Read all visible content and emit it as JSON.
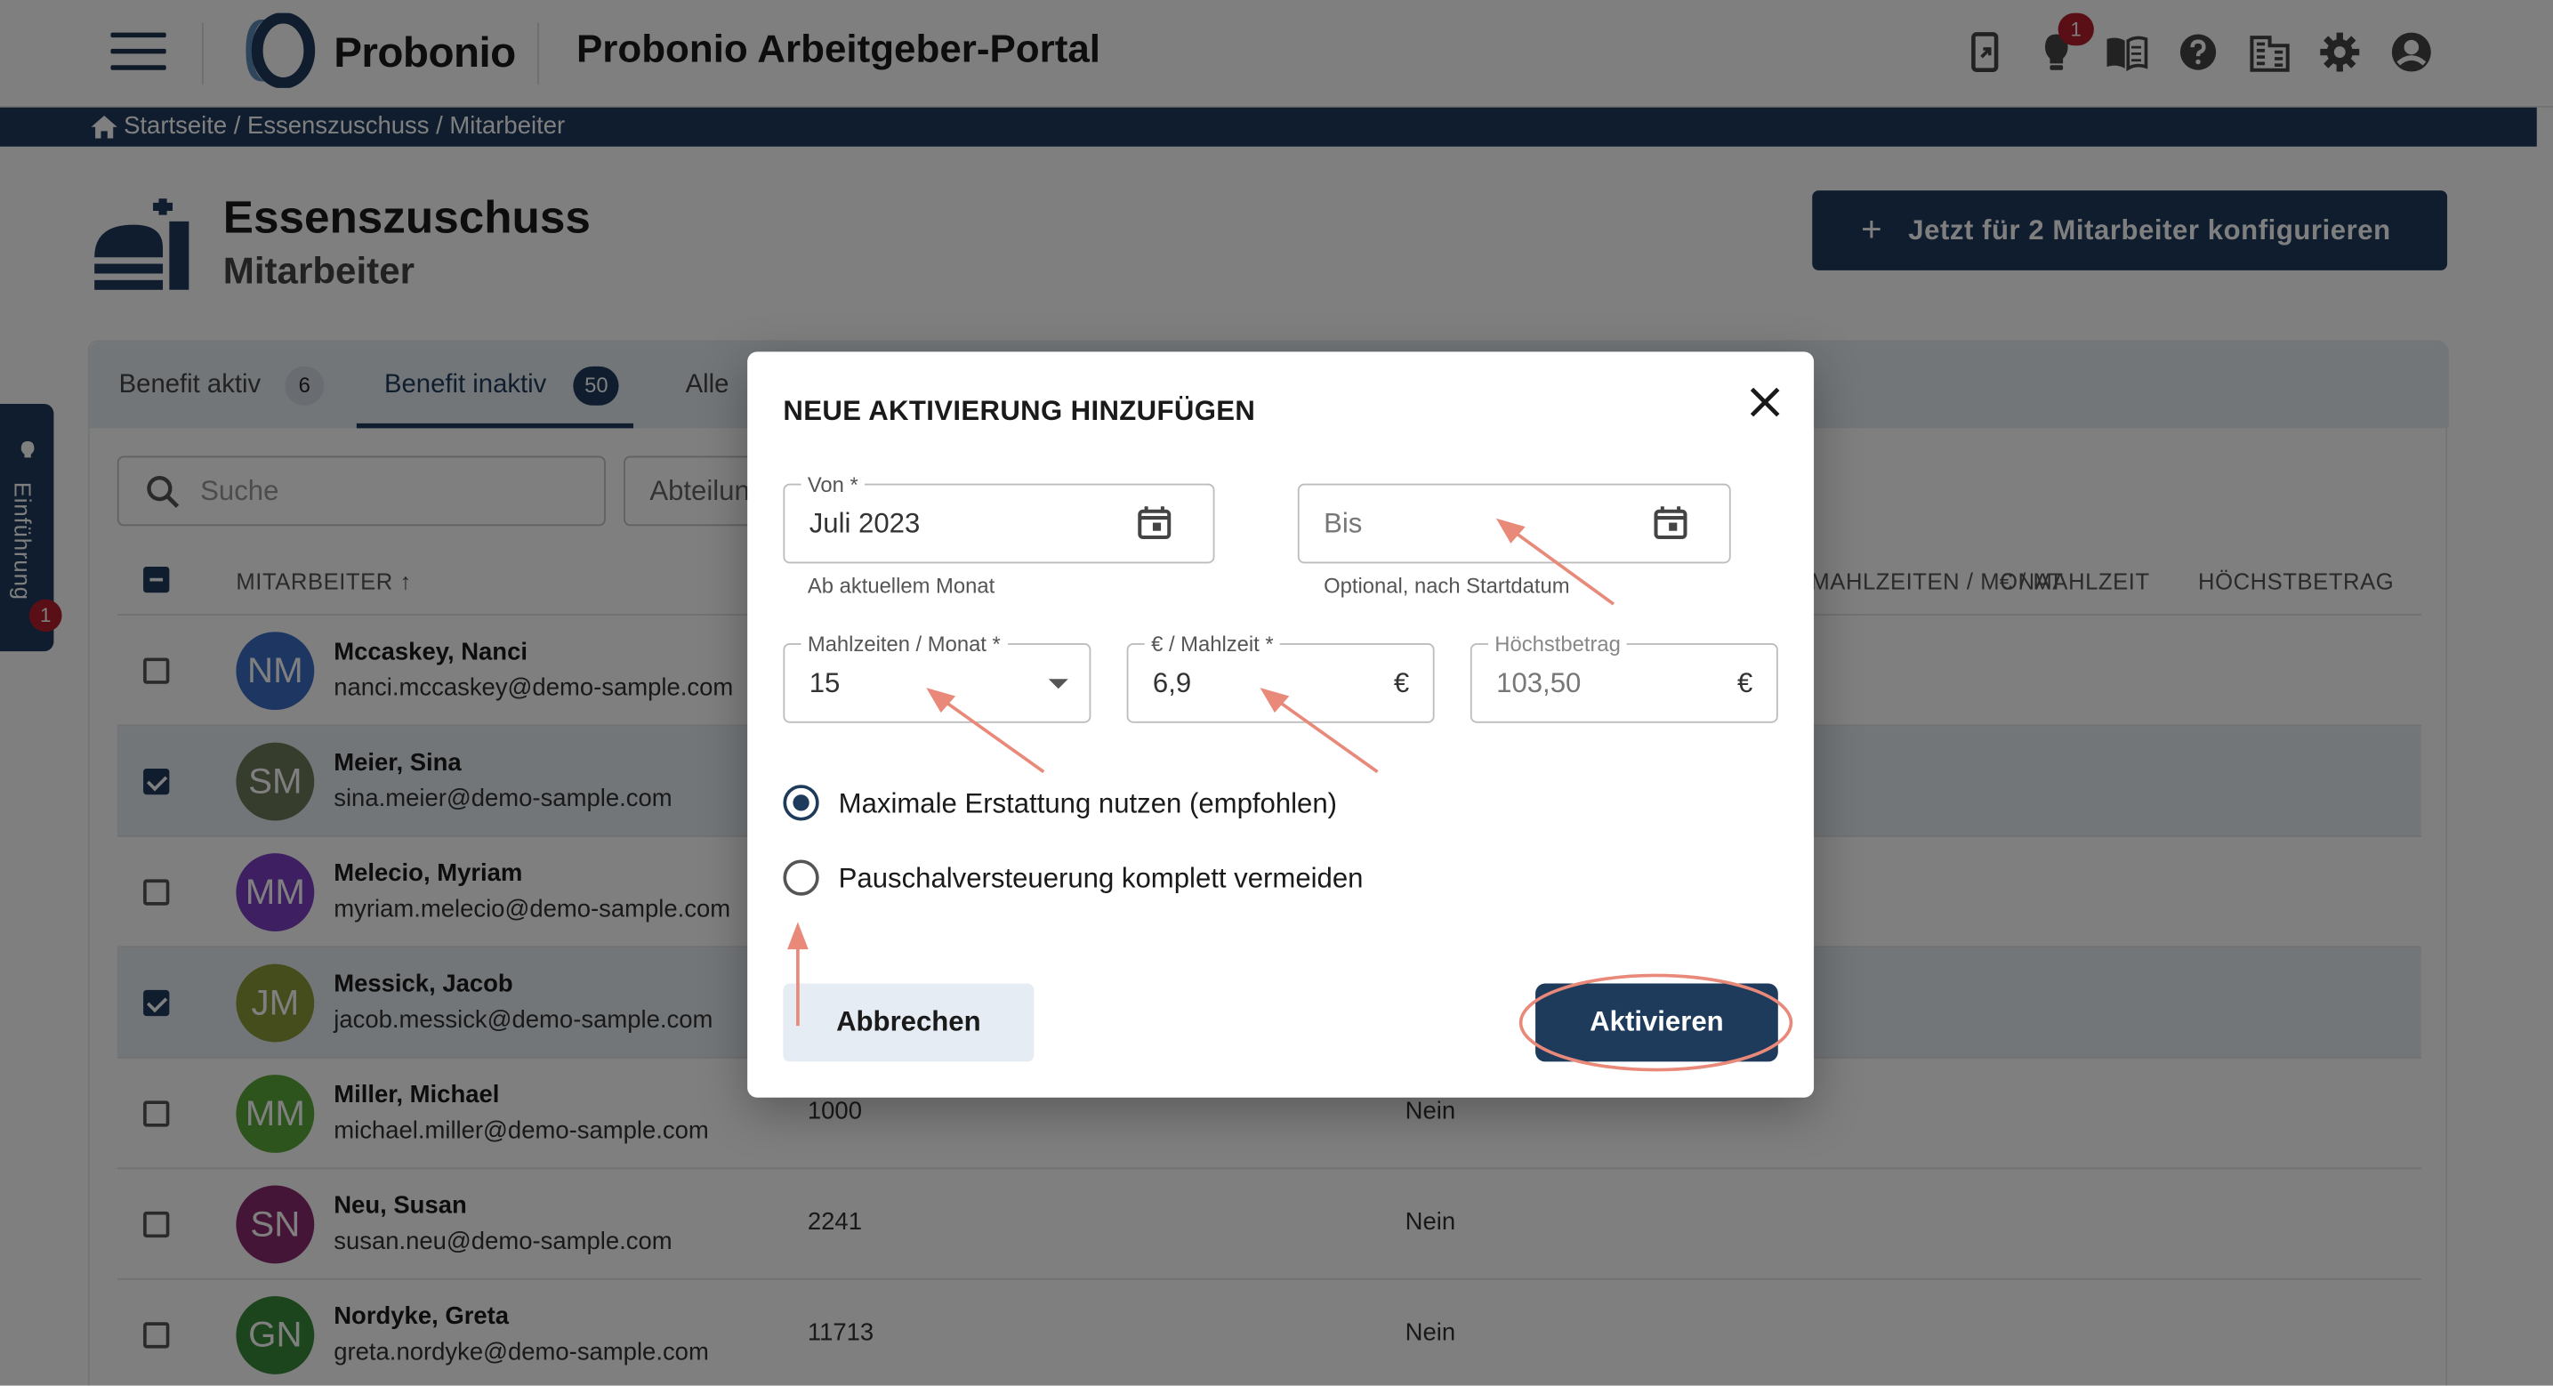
{
  "header": {
    "brand": "Probonio",
    "portal_title": "Probonio Arbeitgeber-Portal",
    "notification_count": "1",
    "icons": [
      "mobile-icon",
      "lightbulb-icon",
      "book-icon",
      "help-icon",
      "building-icon",
      "gear-icon",
      "account-icon"
    ]
  },
  "breadcrumb": {
    "items": [
      "Startseite",
      "Essenszuschuss",
      "Mitarbeiter"
    ],
    "separator": " / "
  },
  "page": {
    "title": "Essenszuschuss",
    "subtitle": "Mitarbeiter",
    "cta_label": "Jetzt für 2 Mitarbeiter konfigurieren"
  },
  "side_tab": {
    "label": "Einführung",
    "badge": "1"
  },
  "tabs": [
    {
      "label": "Benefit aktiv",
      "count": "6"
    },
    {
      "label": "Benefit inaktiv",
      "count": "50"
    },
    {
      "label": "Alle"
    }
  ],
  "filters": {
    "search_placeholder": "Suche",
    "department_placeholder": "Abteilung"
  },
  "table": {
    "columns": {
      "employee": "MITARBEITER",
      "meals": "MAHLZEITEN / MONAT",
      "per_meal": "€ / MAHLZEIT",
      "max": "HÖCHSTBETRAG"
    },
    "rows": [
      {
        "initials": "NM",
        "color": "#3b6fc4",
        "name": "Mccaskey, Nanci",
        "email": "nanci.mccaskey@demo-sample.com",
        "selected": false,
        "number": "",
        "flag": ""
      },
      {
        "initials": "SM",
        "color": "#6d7a5a",
        "name": "Meier, Sina",
        "email": "sina.meier@demo-sample.com",
        "selected": true,
        "number": "",
        "flag": ""
      },
      {
        "initials": "MM",
        "color": "#7a3ec4",
        "name": "Melecio, Myriam",
        "email": "myriam.melecio@demo-sample.com",
        "selected": false,
        "number": "",
        "flag": ""
      },
      {
        "initials": "JM",
        "color": "#8a9a3a",
        "name": "Messick, Jacob",
        "email": "jacob.messick@demo-sample.com",
        "selected": true,
        "number": "",
        "flag": ""
      },
      {
        "initials": "MM",
        "color": "#5aa83a",
        "name": "Miller, Michael",
        "email": "michael.miller@demo-sample.com",
        "selected": false,
        "number": "1000",
        "flag": "Nein"
      },
      {
        "initials": "SN",
        "color": "#8a2a6e",
        "name": "Neu, Susan",
        "email": "susan.neu@demo-sample.com",
        "selected": false,
        "number": "2241",
        "flag": "Nein"
      },
      {
        "initials": "GN",
        "color": "#3a8a3a",
        "name": "Nordyke, Greta",
        "email": "greta.nordyke@demo-sample.com",
        "selected": false,
        "number": "11713",
        "flag": "Nein"
      }
    ]
  },
  "modal": {
    "title": "NEUE AKTIVIERUNG HINZUFÜGEN",
    "from": {
      "label": "Von *",
      "value": "Juli 2023",
      "hint": "Ab aktuellem Monat"
    },
    "to": {
      "placeholder": "Bis",
      "hint": "Optional, nach Startdatum"
    },
    "meals": {
      "label": "Mahlzeiten / Monat *",
      "value": "15"
    },
    "per_meal": {
      "label": "€ / Mahlzeit *",
      "value": "6,9",
      "suffix": "€"
    },
    "max": {
      "label": "Höchstbetrag",
      "value": "103,50",
      "suffix": "€"
    },
    "options": [
      {
        "label": "Maximale Erstattung nutzen (empfohlen)",
        "checked": true
      },
      {
        "label": "Pauschalversteuerung komplett vermeiden",
        "checked": false
      }
    ],
    "cancel_label": "Abbrechen",
    "activate_label": "Aktivieren"
  },
  "colors": {
    "primary": "#1e3b5c",
    "tab_bg": "#e6ecf3",
    "badge": "#b51f2e",
    "annotation": "#e8897a"
  }
}
